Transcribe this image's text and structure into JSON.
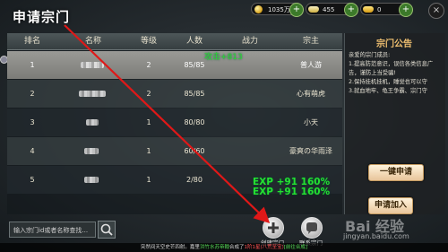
{
  "title": "申请宗门",
  "currency": {
    "gold": "1035万",
    "silver": "455",
    "gold_ingot": "0",
    "plus": "+"
  },
  "close_label": "×",
  "table": {
    "headers": [
      "排名",
      "名称",
      "等级",
      "人数",
      "战力",
      "宗主"
    ],
    "rows": [
      {
        "rank": "1",
        "level": "2",
        "members": "85/85",
        "power": "",
        "leader": "普人游"
      },
      {
        "rank": "2",
        "level": "2",
        "members": "85/85",
        "power": "",
        "leader": "心有萌虎"
      },
      {
        "rank": "3",
        "level": "1",
        "members": "80/80",
        "power": "",
        "leader": "小天"
      },
      {
        "rank": "4",
        "level": "1",
        "members": "60/60",
        "power": "",
        "leader": "豪爽の华雨泽"
      },
      {
        "rank": "5",
        "level": "1",
        "members": "2/80",
        "power": "",
        "leader": ""
      }
    ]
  },
  "floating": {
    "attack": "攻击+813",
    "exp1": "EXP +91 160%",
    "exp2": "EXP +91 160%"
  },
  "panel": {
    "title": "宗门公告",
    "body": "亲爱的宗门成员:\n1.提高防范意识，误信各类信息广告，谨防上当受骗!\n2.保持挂机挂机，睡觉也可以守\n3.就血地牢、龟王争霸、宗门守",
    "apply_button": "一键申请",
    "join_button": "申请加入"
  },
  "bottom": {
    "search_placeholder": "输入宗门id或者名称查找...",
    "create_label": "创建宗门",
    "contact_label": "联系宗门"
  },
  "ticker": {
    "part1": "突然间天空史芒四射。嘉里",
    "part2": "洪竹水苏帝翰",
    "part3": "合成了",
    "part4": "1阶1星(八荒至宝)",
    "part5": "[前往合成]"
  },
  "watermark": {
    "brand": "Bai 经验",
    "site": "jingyan.baidu.com"
  },
  "colors": {
    "accent": "#f0c070",
    "selected_row": "#9a9a96",
    "exp_green": "#25e030",
    "arrow_red": "#e01818"
  }
}
